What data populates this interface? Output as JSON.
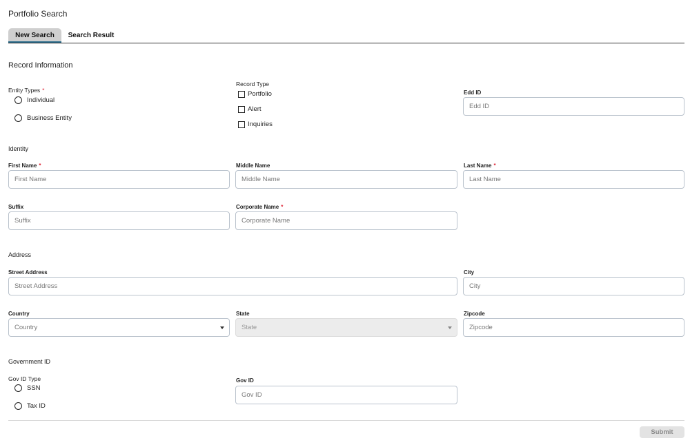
{
  "page_title": "Portfolio Search",
  "tabs": [
    {
      "label": "New Search"
    },
    {
      "label": "Search Result"
    }
  ],
  "record_info": {
    "heading": "Record Information",
    "entity_types": {
      "label": "Entity Types",
      "required": "*",
      "options": [
        "Individual",
        "Business Entity"
      ]
    },
    "record_type": {
      "label": "Record Type",
      "options": [
        "Portfolio",
        "Alert",
        "Inquiries"
      ]
    },
    "edd_id": {
      "label": "Edd ID",
      "placeholder": "Edd ID"
    }
  },
  "identity": {
    "heading": "Identity",
    "first_name": {
      "label": "First Name",
      "required": "*",
      "placeholder": "First Name"
    },
    "middle_name": {
      "label": "Middle Name",
      "placeholder": "Middle Name"
    },
    "last_name": {
      "label": "Last Name",
      "required": "*",
      "placeholder": "Last Name"
    },
    "suffix": {
      "label": "Suffix",
      "placeholder": "Suffix"
    },
    "corporate_name": {
      "label": "Corporate Name",
      "required": "*",
      "placeholder": "Corporate Name"
    }
  },
  "address": {
    "heading": "Address",
    "street": {
      "label": "Street Address",
      "placeholder": "Street Address"
    },
    "city": {
      "label": "City",
      "placeholder": "City"
    },
    "country": {
      "label": "Country",
      "value": "Country"
    },
    "state": {
      "label": "State",
      "value": "State"
    },
    "zipcode": {
      "label": "Zipcode",
      "placeholder": "Zipcode"
    }
  },
  "government_id": {
    "heading": "Government ID",
    "gov_id_type": {
      "label": "Gov ID Type",
      "options": [
        "SSN",
        "Tax ID"
      ]
    },
    "gov_id": {
      "label": "Gov ID",
      "placeholder": "Gov ID"
    }
  },
  "submit_label": "Submit"
}
